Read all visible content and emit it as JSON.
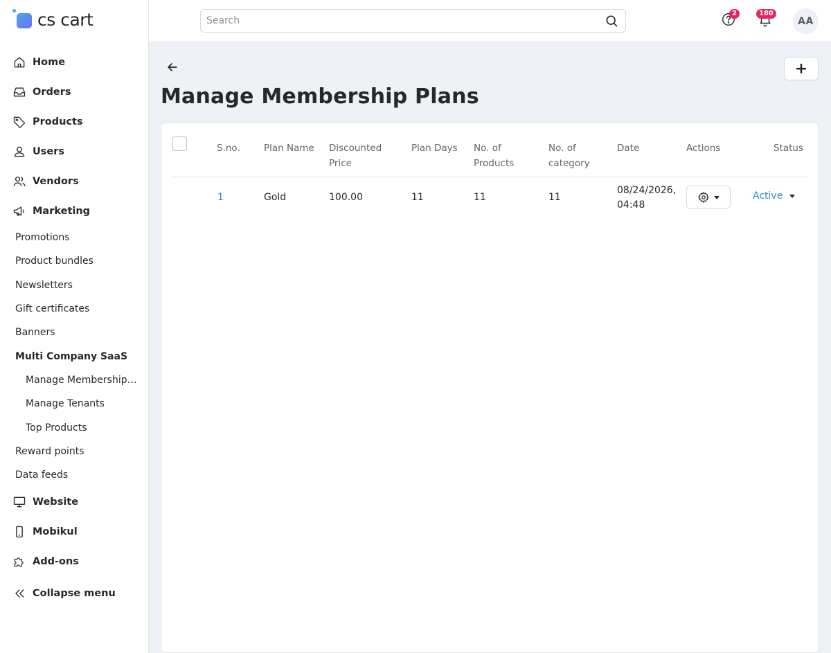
{
  "app": {
    "logo_text": "cs cart"
  },
  "header": {
    "search_placeholder": "Search",
    "help_badge": "2",
    "notifications_badge": "180",
    "avatar_initials": "AA"
  },
  "sidebar": {
    "items": [
      {
        "label": "Home",
        "icon": "home-icon"
      },
      {
        "label": "Orders",
        "icon": "inbox-icon"
      },
      {
        "label": "Products",
        "icon": "tag-icon"
      },
      {
        "label": "Users",
        "icon": "user-icon"
      },
      {
        "label": "Vendors",
        "icon": "users-icon"
      },
      {
        "label": "Marketing",
        "icon": "megaphone-icon"
      }
    ],
    "marketing_sub": [
      "Promotions",
      "Product bundles",
      "Newsletters",
      "Gift certificates",
      "Banners",
      "Multi Company SaaS"
    ],
    "saas_sub": [
      "Manage Membership Plans",
      "Manage Tenants",
      "Top Products"
    ],
    "marketing_sub_after": [
      "Reward points",
      "Data feeds"
    ],
    "bottom_items": [
      {
        "label": "Website",
        "icon": "monitor-icon"
      },
      {
        "label": "Mobikul",
        "icon": "mobile-icon"
      },
      {
        "label": "Add-ons",
        "icon": "puzzle-icon"
      }
    ],
    "collapse_label": "Collapse menu"
  },
  "page": {
    "title": "Manage Membership Plans",
    "add_label": "+"
  },
  "table": {
    "headers": {
      "sno": "S.no.",
      "plan_name": "Plan Name",
      "discounted_price_1": "Discounted",
      "discounted_price_2": "Price",
      "plan_days": "Plan Days",
      "no_products_1": "No. of",
      "no_products_2": "Products",
      "no_category_1": "No. of",
      "no_category_2": "category",
      "date": "Date",
      "actions": "Actions",
      "status": "Status"
    },
    "rows": [
      {
        "sno": "1",
        "plan_name": "Gold",
        "discounted_price": "100.00",
        "plan_days": "11",
        "no_products": "11",
        "no_category": "11",
        "date_line1": "08/24/2026,",
        "date_line2": "04:48",
        "status": "Active"
      }
    ]
  },
  "colors": {
    "link": "#2b8dd6",
    "badge": "#e8255b",
    "logo_gradient_start": "#4aa6f3",
    "logo_gradient_end": "#6d6ff0"
  }
}
